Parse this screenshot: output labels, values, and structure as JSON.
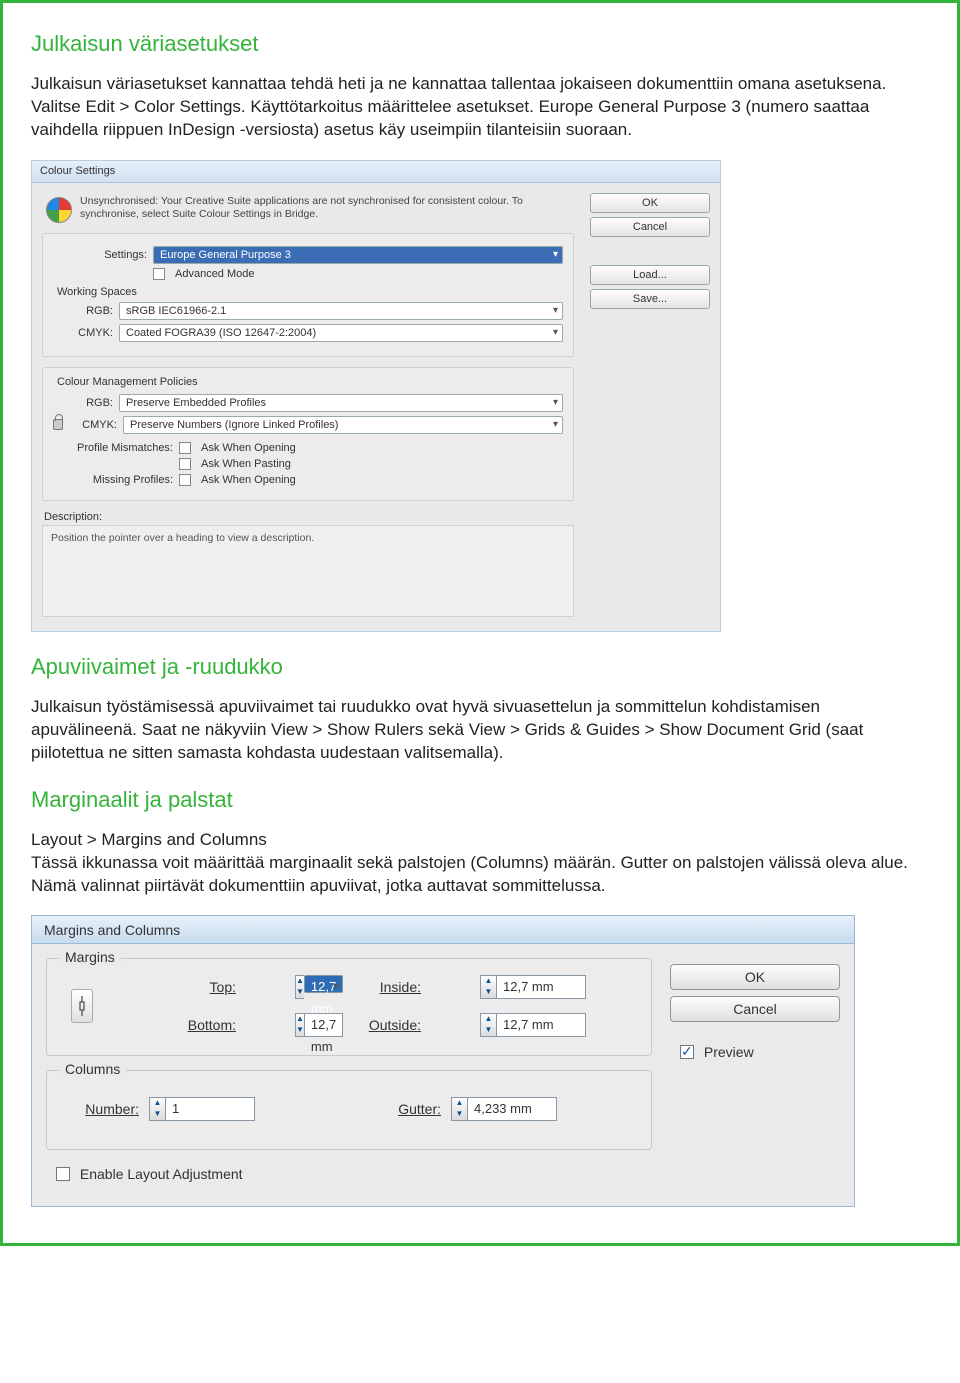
{
  "section1": {
    "heading": "Julkaisun väriasetukset",
    "para": "Julkaisun väriasetukset kannattaa tehdä heti ja ne kannattaa tallentaa jokaiseen dokumenttiin omana asetuksena. Valitse Edit > Color Settings. Käyttötarkoitus määrittelee asetukset. Europe General Purpose 3 (numero saattaa vaihdella riippuen InDesign -versiosta) asetus käy useimpiin tilanteisiin suoraan."
  },
  "colourDialog": {
    "title": "Colour Settings",
    "syncMsg": "Unsynchronised: Your Creative Suite applications are not synchronised for consistent colour. To synchronise, select Suite Colour Settings in Bridge.",
    "btnOK": "OK",
    "btnCancel": "Cancel",
    "btnLoad": "Load...",
    "btnSave": "Save...",
    "settingsLabel": "Settings:",
    "settingsValue": "Europe General Purpose 3",
    "advanced": "Advanced Mode",
    "workingSpacesLabel": "Working Spaces",
    "rgbLabel": "RGB:",
    "rgbValue": "sRGB IEC61966-2.1",
    "cmykLabel": "CMYK:",
    "cmykValue": "Coated FOGRA39 (ISO 12647-2:2004)",
    "policiesLabel": "Colour Management Policies",
    "polRgb": "Preserve Embedded Profiles",
    "polCmyk": "Preserve Numbers (Ignore Linked Profiles)",
    "mismatchLabel": "Profile Mismatches:",
    "askOpen": "Ask When Opening",
    "askPaste": "Ask When Pasting",
    "missingLabel": "Missing Profiles:",
    "descLabel": "Description:",
    "descText": "Position the pointer over a heading to view a description."
  },
  "section2": {
    "heading": "Apuviivaimet ja -ruudukko",
    "para": "Julkaisun työstämisessä apuviivaimet tai ruudukko ovat hyvä sivuasettelun ja sommittelun kohdistamisen apuvälineenä. Saat ne näkyviin View > Show Rulers sekä View > Grids & Guides > Show Document Grid (saat piilotettua ne sitten samasta kohdasta uudestaan valitsemalla)."
  },
  "section3": {
    "heading": "Marginaalit ja palstat",
    "intro": "Layout > Margins and Columns",
    "para": "Tässä ikkunassa voit määrittää marginaalit sekä palstojen (Columns) määrän. Gutter on palstojen välissä oleva alue. Nämä valinnat piirtävät dokumenttiin apuviivat, jotka auttavat sommittelussa."
  },
  "marginsDialog": {
    "title": "Margins and Columns",
    "marginsLegend": "Margins",
    "topLabel": "Top:",
    "topValue": "12,7 mm",
    "bottomLabel": "Bottom:",
    "bottomValue": "12,7 mm",
    "insideLabel": "Inside:",
    "insideValue": "12,7 mm",
    "outsideLabel": "Outside:",
    "outsideValue": "12,7 mm",
    "columnsLegend": "Columns",
    "numberLabel": "Number:",
    "numberValue": "1",
    "gutterLabel": "Gutter:",
    "gutterValue": "4,233 mm",
    "enableLayout": "Enable Layout Adjustment",
    "btnOK": "OK",
    "btnCancel": "Cancel",
    "preview": "Preview"
  }
}
